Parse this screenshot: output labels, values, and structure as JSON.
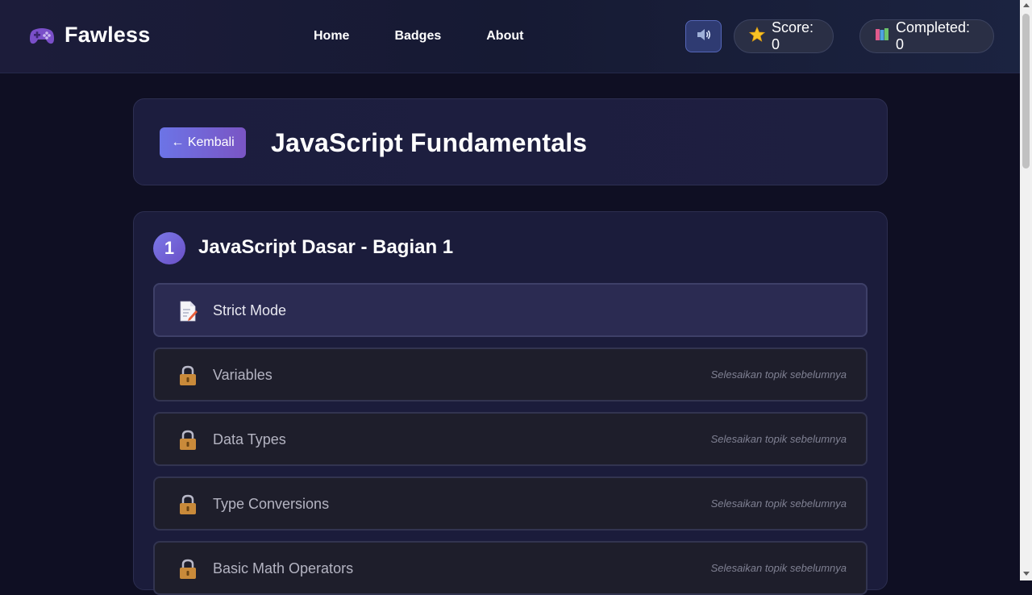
{
  "app": {
    "brand": "Fawless",
    "logo_icon": "gamepad-icon"
  },
  "nav": {
    "home": "Home",
    "badges": "Badges",
    "about": "About"
  },
  "header_controls": {
    "sound_icon": "speaker-icon",
    "score_label": "Score: 0",
    "score_icon": "star-icon",
    "completed_label": "Completed: 0",
    "completed_icon": "books-icon"
  },
  "page": {
    "back_label": "← Kembali",
    "title": "JavaScript Fundamentals"
  },
  "section": {
    "number": "1",
    "title": "JavaScript Dasar - Bagian 1",
    "topics": [
      {
        "name": "Strict Mode",
        "status": "available",
        "icon": "memo-icon",
        "hint": ""
      },
      {
        "name": "Variables",
        "status": "locked",
        "icon": "lock-icon",
        "hint": "Selesaikan topik sebelumnya"
      },
      {
        "name": "Data Types",
        "status": "locked",
        "icon": "lock-icon",
        "hint": "Selesaikan topik sebelumnya"
      },
      {
        "name": "Type Conversions",
        "status": "locked",
        "icon": "lock-icon",
        "hint": "Selesaikan topik sebelumnya"
      },
      {
        "name": "Basic Math Operators",
        "status": "locked",
        "icon": "lock-icon",
        "hint": "Selesaikan topik sebelumnya"
      }
    ]
  },
  "colors": {
    "accent": "#6c74e6",
    "accent_alt": "#7a55c4",
    "background": "#0f0f23",
    "card": "#1b1c3b"
  }
}
